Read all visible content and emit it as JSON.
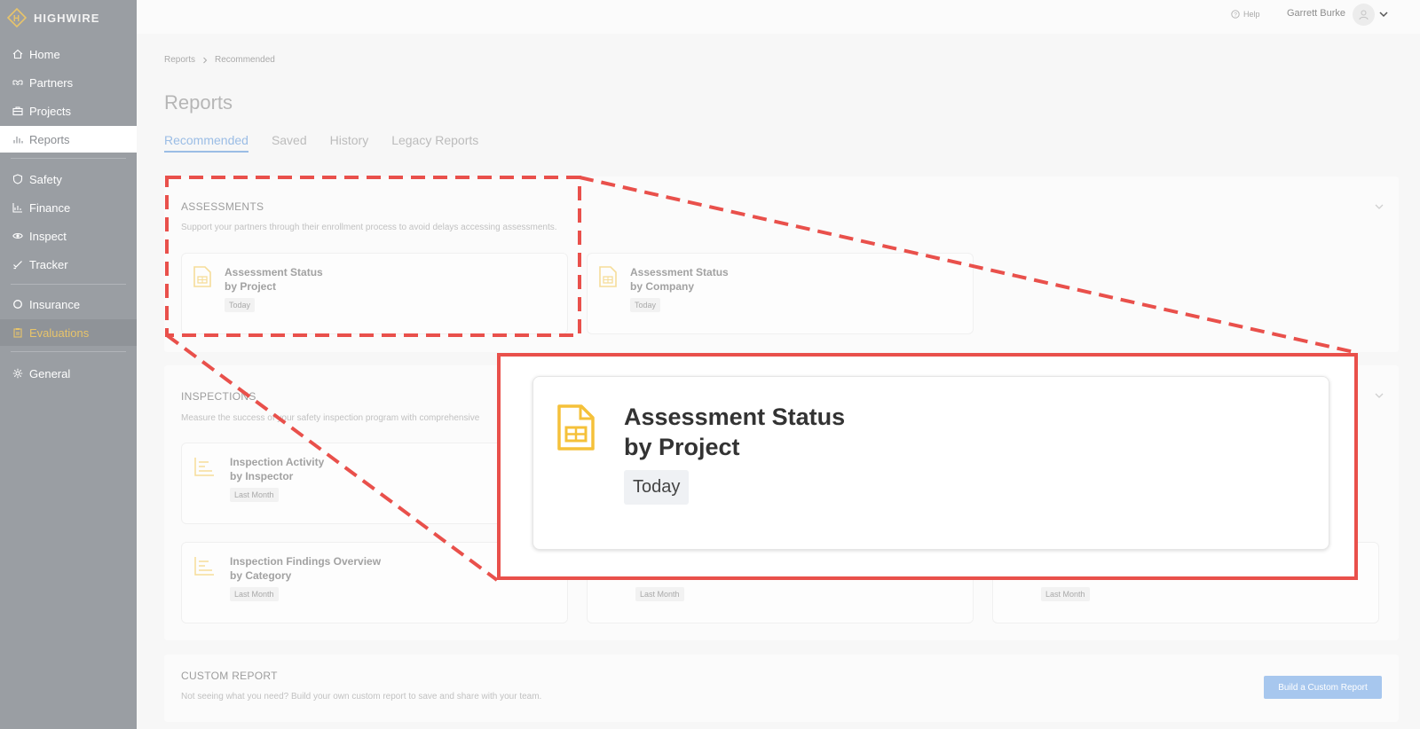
{
  "brand": {
    "name": "HIGHWIRE",
    "logo_letter": "H"
  },
  "sidebar": {
    "items": [
      {
        "label": "Home",
        "icon": "home-icon"
      },
      {
        "label": "Partners",
        "icon": "handshake-icon"
      },
      {
        "label": "Projects",
        "icon": "briefcase-icon"
      },
      {
        "label": "Reports",
        "icon": "bar-chart-icon",
        "active": true
      },
      {
        "label": "Safety",
        "icon": "shield-icon"
      },
      {
        "label": "Finance",
        "icon": "line-chart-icon"
      },
      {
        "label": "Inspect",
        "icon": "eye-icon"
      },
      {
        "label": "Tracker",
        "icon": "check-icon"
      },
      {
        "label": "Insurance",
        "icon": "circle-icon"
      },
      {
        "label": "Evaluations",
        "icon": "clipboard-icon",
        "highlight": true
      },
      {
        "label": "General",
        "icon": "gear-icon"
      }
    ]
  },
  "topbar": {
    "help_label": "Help",
    "user_name": "Garrett Burke"
  },
  "breadcrumb": {
    "parent": "Reports",
    "current": "Recommended"
  },
  "page": {
    "title": "Reports"
  },
  "tabs": [
    {
      "label": "Recommended",
      "active": true
    },
    {
      "label": "Saved"
    },
    {
      "label": "History"
    },
    {
      "label": "Legacy Reports"
    }
  ],
  "sections": {
    "assessments": {
      "title": "ASSESSMENTS",
      "description": "Support your partners through their enrollment process to avoid delays accessing assessments.",
      "cards": [
        {
          "line1": "Assessment Status",
          "line2": "by Project",
          "badge": "Today"
        },
        {
          "line1": "Assessment Status",
          "line2": "by Company",
          "badge": "Today"
        }
      ]
    },
    "inspections": {
      "title": "INSPECTIONS",
      "description": "Measure the success of your safety inspection program with comprehensive",
      "cards": [
        {
          "line1": "Inspection Activity",
          "line2": "by Inspector",
          "badge": "Last Month"
        },
        {
          "line1": "Inspection Findings Overview",
          "line2": "by Category",
          "badge": "Last Month"
        },
        {
          "badge": "Last Month"
        },
        {
          "badge": "Last Month"
        }
      ]
    },
    "custom": {
      "title": "CUSTOM REPORT",
      "description": "Not seeing what you need? Build your own custom report to save and share with your team.",
      "button_label": "Build a Custom Report"
    }
  },
  "zoom": {
    "line1": "Assessment Status",
    "line2": "by Project",
    "badge": "Today"
  },
  "colors": {
    "accent": "#9bbde5",
    "annotation": "#e9504b",
    "icon_yellow": "#f5c13a"
  }
}
